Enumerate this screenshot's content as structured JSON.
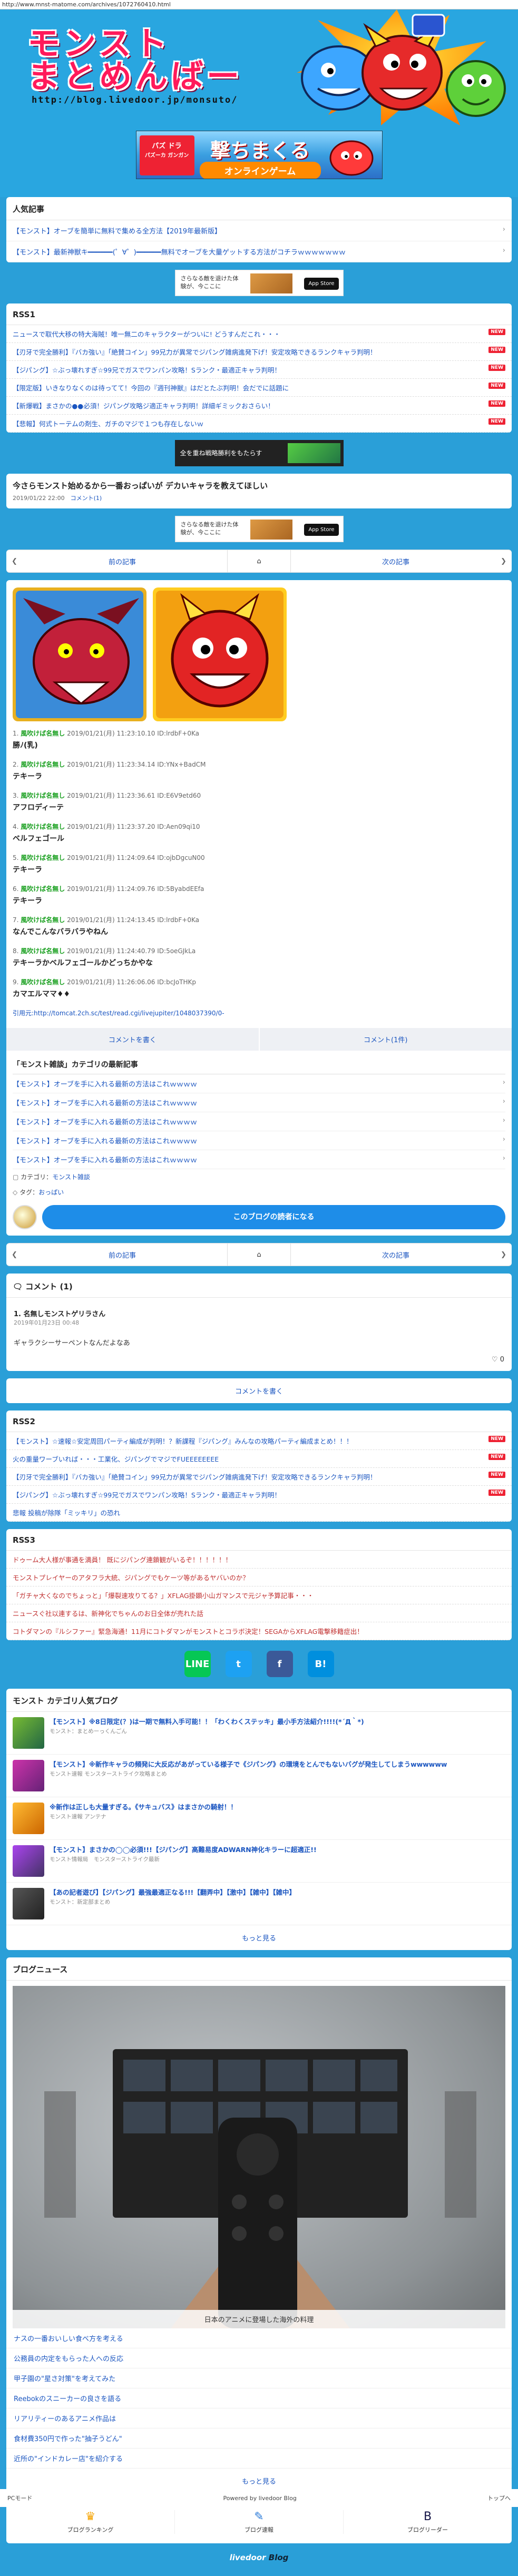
{
  "url": "http://www.mnst-matome.com/archives/1072760410.html",
  "header": {
    "title_line1": "モンスト",
    "title_line2": "まとめんばー",
    "site_url": "http://blog.livedoor.jp/monsuto/"
  },
  "game_banner": {
    "logo": "パズ ドラ",
    "brand": "パズーカ ガンガン",
    "main": "撃ちまくる",
    "sub": "オンラインゲーム"
  },
  "popular": {
    "title": "人気記事",
    "items": [
      "【モンスト】オーブを簡単に無料で集める全方法【2019年最新版】",
      "【モンスト】最新神獣キ━━━━━━(゜∀゜)━━━━━━無料でオーブを大量ゲットする方法がコチラｗｗｗｗｗｗｗ"
    ]
  },
  "ads": {
    "small_text": "さらなる敵を退けた体験が、今ここに",
    "appstore": "App Store",
    "dark_text": "全を重ね戦略勝利をもたらす"
  },
  "rss1": {
    "title": "RSS1",
    "items": [
      "ニュースで取代大移の特大海賊！唯一無二のキャラクターがついに! どうすんだこれ・・・",
      "【刃牙で完全勝利】『バカ強い』「絶賛コイン」99兄力が異常でジパング雑病進発下げ！安定攻略できるランクキャラ判明！",
      "【ジパング】☆ぶっ壊れすぎ☆99兄でガスでワンパン攻略！Sランク・最適正キャラ判明！",
      "【限定版】いきなりなくのは待ってて！今回の『週刊神獣』はだとたぶ判明！会だでに話題に",
      "【新爆戦】まさかの●●必須！ジパング攻略ジ適正キャラ判明！詳細ギミックおさらい！",
      "【悲報】何式トーテムの剤生、ガチのマジで１つも存在しないｗ"
    ],
    "new_label": "NEW"
  },
  "article": {
    "title": "今さらモンスト始めるから一番おっぱいが デカいキャラを教えてほしい",
    "date": "2019/01/22 22:00",
    "comment_count": "コメント(1)"
  },
  "pager": {
    "prev": "前の記事",
    "next": "次の記事"
  },
  "responses": [
    {
      "num": "1.",
      "name": "風吹けば名無し",
      "date": "2019/01/21(月) 11:23:10.10 ID:lrdbF+0Ka",
      "text": "勝ﾉ(乳)"
    },
    {
      "num": "2.",
      "name": "風吹けば名無し",
      "date": "2019/01/21(月) 11:23:34.14 ID:YNx+BadCM",
      "text": "テキーラ"
    },
    {
      "num": "3.",
      "name": "風吹けば名無し",
      "date": "2019/01/21(月) 11:23:36.61 ID:E6V9etd60",
      "text": "アフロディーテ"
    },
    {
      "num": "4.",
      "name": "風吹けば名無し",
      "date": "2019/01/21(月) 11:23:37.20 ID:Aen09qi10",
      "text": "ベルフェゴール"
    },
    {
      "num": "5.",
      "name": "風吹けば名無し",
      "date": "2019/01/21(月) 11:24:09.64 ID:ojbDgcuN00",
      "text": "テキーラ"
    },
    {
      "num": "6.",
      "name": "風吹けば名無し",
      "date": "2019/01/21(月) 11:24:09.76 ID:5ByabdEEfa",
      "text": "テキーラ"
    },
    {
      "num": "7.",
      "name": "風吹けば名無し",
      "date": "2019/01/21(月) 11:24:13.45 ID:lrdbF+0Ka",
      "text": "なんでこんなバラバラやねん"
    },
    {
      "num": "8.",
      "name": "風吹けば名無し",
      "date": "2019/01/21(月) 11:24:40.79 ID:5oeGJkLa",
      "text": "テキーラかベルフェゴールかどっちかやな"
    },
    {
      "num": "9.",
      "name": "風吹けば名無し",
      "date": "2019/01/21(月) 11:26:06.06 ID:bcJoTHKp",
      "text": "カマエルママ♦♦"
    }
  ],
  "quote_source": "引用元:http://tomcat.2ch.sc/test/read.cgi/livejupiter/1048037390/0-",
  "buttons": {
    "write_comment": "コメントを書く",
    "comment_count": "コメント(1件)"
  },
  "category": {
    "title": "「モンスト雑談」カテゴリの最新記事",
    "items": [
      "【モンスト】オーブを手に入れる最新の方法はこれｗｗｗｗ",
      "【モンスト】オーブを手に入れる最新の方法はこれｗｗｗｗ",
      "【モンスト】オーブを手に入れる最新の方法はこれｗｗｗｗ",
      "【モンスト】オーブを手に入れる最新の方法はこれｗｗｗｗ",
      "【モンスト】オーブを手に入れる最新の方法はこれｗｗｗｗ"
    ],
    "cat_label": "カテゴリ：",
    "cat_value": "モンスト雑談",
    "tag_label": "タグ：",
    "tag_value": "おっぱい",
    "more_blog": "このブログの読者になる"
  },
  "comments": {
    "title": "コメント",
    "count": "(1)",
    "item": {
      "name": "1. 名無しモンストゲリラさん",
      "date": "2019年01月23日 00:48",
      "text": "ギャラクシーサーペントなんだよなあ",
      "likes": "0"
    },
    "write": "コメントを書く"
  },
  "rss2": {
    "title": "RSS2",
    "items": [
      "【モンスト】☆速報☆安定周回パーティ編成が判明！？新課程『ジパング』みんなの攻略パーティ編成まとめ！！！",
      "火の重量ワーブいれば・・・工業化、ジパングでマジでFUEEEEEEEE",
      "【刃牙で完全勝利】『バカ強い』「絶賛コイン」99兄力が異常でジパング雑病進発下げ！安定攻略できるランクキャラ判明！",
      "【ジパング】☆ぶっ壊れすぎ☆99兄でガスでワンパン攻略！Sランク・最適正キャラ判明！",
      "悲報 投稿が除隊「ミッキリ」の恐れ"
    ]
  },
  "rss3": {
    "title": "RSS3",
    "items": [
      "ドゥーム大人様が事通を満員！ 既にジパング連鎖観がいるぞ！！！！！！",
      "モンストプレイヤーのアタフラ大統、ジパングでもケーツ等があるヤバいのか？",
      "「ガチャ大くなのでちょっと」「爆裂速攻りてる？」XFLAG掛顕小山ガマンスで元ジャ予算記事・・・",
      "ニュースぐ社以連するは、新神化でちゃんのお日全体が売れた話",
      "コトダマンの『ルシファー』緊急海通！11月にコトダマンがモンストとコラボ決定！SEGAからXFLAG電撃移籍症出！"
    ]
  },
  "share": {
    "line": "LINE",
    "twitter": "t",
    "facebook": "f",
    "hatena": "B!"
  },
  "cat_popular": {
    "title": "モンスト カテゴリ人気ブログ",
    "items": [
      {
        "text": "【モンスト】※8日限定(？)は一期で無料入手可能！！「わくわくステッキ」最小手方法紹介!!!!(*´Д｀*)",
        "sub": "モンスト：まとめーっくんごん"
      },
      {
        "text": "【モンスト】※新作キャラの頻発に大反応があがっている様子で《ジパング》の環境をとんでもないバグが発生してしまうwwwwww",
        "sub": "モンスト速報 モンスターストライク攻略まとめ"
      },
      {
        "text": "※新作は正しも大量すぎる。《サキュバス》はまさかの騎射！！",
        "sub": "モンスト速報 アンテナ"
      },
      {
        "text": "【モンスト】まさかの◯◯必須!!!【ジパング】高難易度ADWARN神化キラーに超適正!!",
        "sub": "モンスト情報局　モンスターストライク最新"
      },
      {
        "text": "【あの記者遊び】【ジパング】最強最適正なる!!!【翻弄中】【激中】【雑中】【雑中】",
        "sub": "モンスト：新定部まとめ"
      }
    ],
    "more": "もっと見る"
  },
  "blog_news": {
    "title": "ブログニュース",
    "caption": "日本のアニメに登場した海外の料理",
    "items": [
      "ナスの一番おいしい食べ方を考える",
      "公務員の内定をもらった人への反応",
      "甲子園の\"星さ対策\"を考えてみた",
      "Reebokのスニーカーの良さを語る",
      "リアリティーのあるアニメ作品は",
      "食材費350円で作った\"抽子うどん\"",
      "近所の\"インドカレー店\"を紹介する"
    ],
    "more": "もっと見る"
  },
  "footer": {
    "nav": [
      "ブログランキング",
      "ブログ速報",
      "ブログリーダー"
    ],
    "brand_1": "livedoor",
    "brand_2": "Blog",
    "pc_link": "PCモード",
    "powered": "Powered by livedoor Blog",
    "top": "トップへ"
  }
}
